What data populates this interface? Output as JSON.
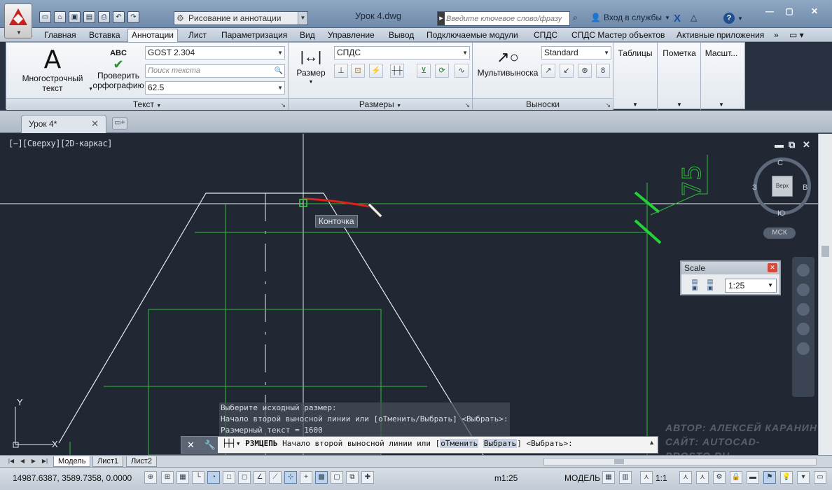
{
  "titlebar": {
    "workspace": "Рисование и аннотации",
    "document_title": "Урок 4.dwg",
    "search_placeholder": "Введите ключевое слово/фразу",
    "signin": "Вход в службы",
    "help": "?"
  },
  "ribbon_tabs": [
    "Главная",
    "Вставка",
    "Аннотации",
    "Лист",
    "Параметризация",
    "Вид",
    "Управление",
    "Вывод",
    "Подключаемые модули",
    "СПДС",
    "СПДС Мастер объектов",
    "Активные приложения"
  ],
  "ribbon_tabs_active": "Аннотации",
  "ribbon": {
    "text_panel": {
      "mtext_line1": "Многострочный",
      "mtext_line2": "текст",
      "spell_icon_text": "ABC",
      "spell_line1": "Проверить",
      "spell_line2": "орфографию",
      "text_style": "GOST 2.304",
      "find_placeholder": "Поиск текста",
      "text_height": "62.5",
      "title": "Текст"
    },
    "dim_panel": {
      "dim_label": "Размер",
      "dim_style": "СПДС",
      "title": "Размеры"
    },
    "leader_panel": {
      "multileader": "Мультивыноска",
      "mleader_style": "Standard",
      "title": "Выноски"
    },
    "tables": "Таблицы",
    "markup": "Пометка",
    "scale": "Масшт..."
  },
  "file_tab": {
    "label": "Урок 4*"
  },
  "viewport": {
    "label": "[−][Сверху][2D-каркас]",
    "viewcube": {
      "top": "Верх",
      "north": "С",
      "south": "Ю",
      "west": "З",
      "east": "В",
      "wcs": "МСК"
    },
    "tooltip": "Конточка",
    "dim_text_on_drawing": "75"
  },
  "command_history": [
    "Выберите исходный размер:",
    "Начало второй выносной линии или [оТменить/Выбрать] <Выбрать>:",
    "Размерный текст = 1600"
  ],
  "watermark": {
    "line1": "АВТОР: АЛЕКСЕЙ КАРАНИН",
    "line2": "САЙТ: AUTOCAD-PROSTO.RU"
  },
  "scale_palette": {
    "title": "Scale",
    "value": "1:25"
  },
  "command_line": {
    "command": "РЗМЦЕПЬ",
    "prompt": "Начало второй выносной линии или [",
    "option1": "оТменить",
    "option2": "Выбрать",
    "suffix": "] <Выбрать>:"
  },
  "layout_tabs": [
    "Модель",
    "Лист1",
    "Лист2"
  ],
  "statusbar": {
    "coords": "14987.6387, 3589.7358, 0.0000",
    "annotation_scale": "m1:25",
    "model": "МОДЕЛЬ",
    "viewport_scale": "1:1"
  }
}
